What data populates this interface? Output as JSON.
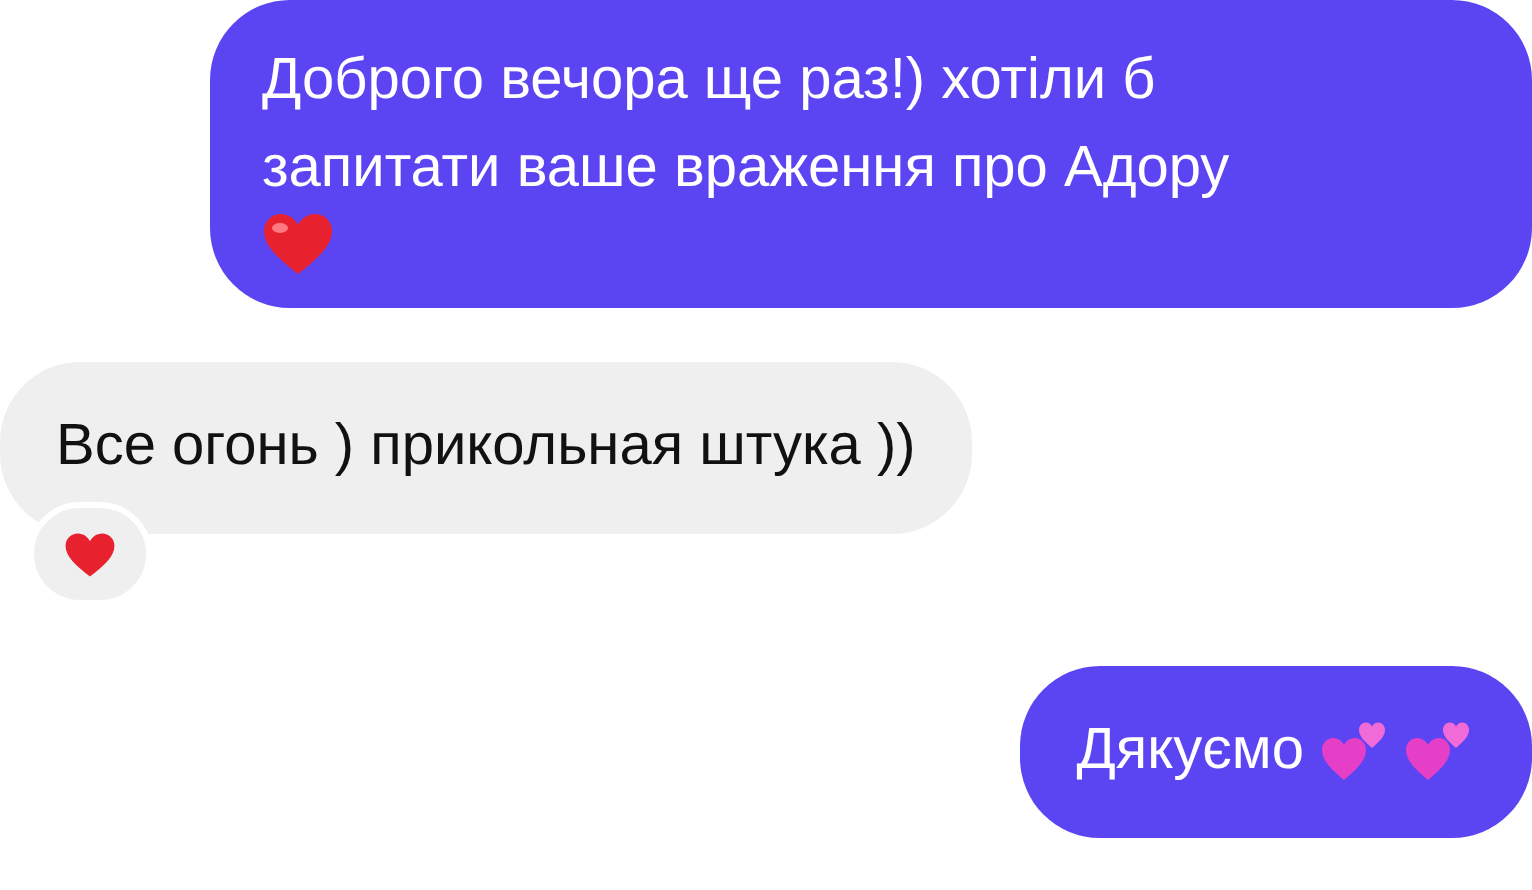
{
  "messages": [
    {
      "text": "Доброго вечора ще раз!) хотіли б запитати ваше враження про Адору",
      "outgoing": true,
      "emoji": [
        {
          "kind": "heart"
        }
      ],
      "reaction": false
    },
    {
      "text": "Все огонь ) прикольная штука ))",
      "outgoing": false,
      "reaction": true
    },
    {
      "text": "Дякуємо",
      "outgoing": true,
      "emoji": [
        {
          "kind": "two-hearts"
        },
        {
          "kind": "two-hearts"
        }
      ],
      "reaction": false
    }
  ]
}
